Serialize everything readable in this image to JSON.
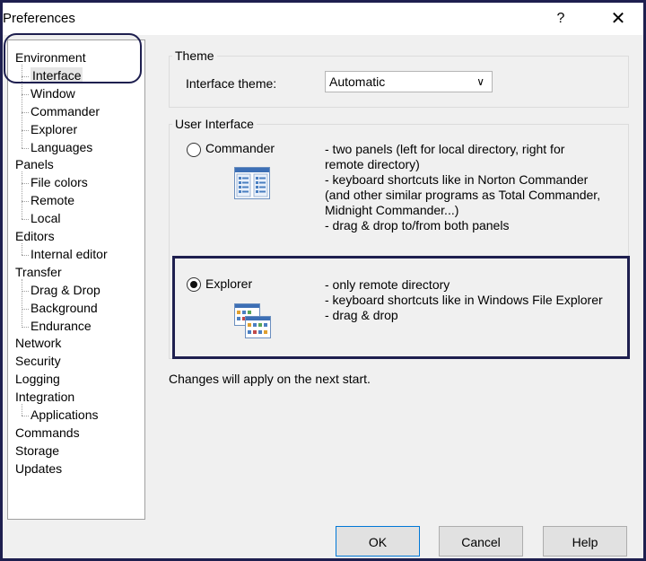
{
  "window": {
    "title": "Preferences",
    "help_glyph": "?",
    "close_glyph": "✕"
  },
  "tree": {
    "items": [
      {
        "label": "Environment",
        "level": 0
      },
      {
        "label": "Interface",
        "level": 1,
        "selected": true
      },
      {
        "label": "Window",
        "level": 1
      },
      {
        "label": "Commander",
        "level": 1
      },
      {
        "label": "Explorer",
        "level": 1
      },
      {
        "label": "Languages",
        "level": 1
      },
      {
        "label": "Panels",
        "level": 0
      },
      {
        "label": "File colors",
        "level": 1
      },
      {
        "label": "Remote",
        "level": 1
      },
      {
        "label": "Local",
        "level": 1
      },
      {
        "label": "Editors",
        "level": 0
      },
      {
        "label": "Internal editor",
        "level": 1
      },
      {
        "label": "Transfer",
        "level": 0
      },
      {
        "label": "Drag & Drop",
        "level": 1
      },
      {
        "label": "Background",
        "level": 1
      },
      {
        "label": "Endurance",
        "level": 1
      },
      {
        "label": "Network",
        "level": 0
      },
      {
        "label": "Security",
        "level": 0
      },
      {
        "label": "Logging",
        "level": 0
      },
      {
        "label": "Integration",
        "level": 0
      },
      {
        "label": "Applications",
        "level": 1
      },
      {
        "label": "Commands",
        "level": 0
      },
      {
        "label": "Storage",
        "level": 0
      },
      {
        "label": "Updates",
        "level": 0
      }
    ]
  },
  "theme": {
    "group_title": "Theme",
    "label": "Interface theme:",
    "value": "Automatic"
  },
  "ui": {
    "group_title": "User Interface",
    "commander": {
      "label": "Commander",
      "checked": false,
      "desc": [
        "- two panels (left for local directory, right for",
        "remote directory)",
        "- keyboard shortcuts like in Norton Commander",
        "(and other similar programs as Total Commander,",
        "Midnight Commander...)",
        "- drag & drop to/from both panels"
      ]
    },
    "explorer": {
      "label": "Explorer",
      "checked": true,
      "desc": [
        "- only remote directory",
        "- keyboard shortcuts like in Windows File Explorer",
        "- drag & drop"
      ]
    }
  },
  "footnote": "Changes will apply on the next start.",
  "buttons": {
    "ok": "OK",
    "cancel": "Cancel",
    "help": "Help"
  }
}
